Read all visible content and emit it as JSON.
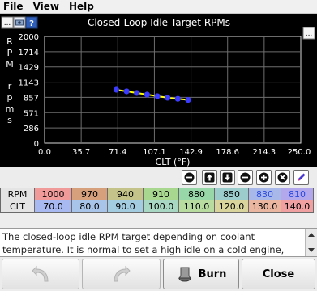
{
  "menu": {
    "items": [
      "File",
      "View",
      "Help"
    ]
  },
  "chart": {
    "title": "Closed-Loop Idle Target RPMs",
    "ylabel_top": "RPM",
    "ylabel_bottom": "rpms",
    "xlabel": "CLT (°F)",
    "yticks": [
      "2000",
      "1714",
      "1429",
      "1143",
      "857",
      "571",
      "286",
      "0"
    ],
    "xticks": [
      "0.0",
      "35.7",
      "71.4",
      "107.1",
      "142.9",
      "178.6",
      "214.3",
      "250.0"
    ],
    "background": "#000000",
    "line_color": "#ffff00",
    "point_color": "#3c3cff"
  },
  "chart_data": {
    "type": "line",
    "title": "Closed-Loop Idle Target RPMs",
    "xlabel": "CLT (°F)",
    "ylabel": "RPM rpms",
    "x": [
      70.0,
      80.0,
      90.0,
      100.0,
      110.0,
      120.0,
      130.0,
      140.0
    ],
    "series": [
      {
        "values": [
          1000,
          970,
          940,
          910,
          880,
          850,
          830,
          810
        ]
      }
    ],
    "xlim": [
      0.0,
      250.0
    ],
    "ylim": [
      0,
      2000
    ],
    "grid": true
  },
  "toolbar": {
    "icons": [
      "minus-circle-icon",
      "arrow-up-icon",
      "arrow-down-icon",
      "minus-circle-icon",
      "plus-circle-icon",
      "times-circle-icon",
      "pen-icon"
    ]
  },
  "table": {
    "rpm_label": "RPM",
    "clt_label": "CLT",
    "rpm": [
      "1000",
      "970",
      "940",
      "910",
      "880",
      "850",
      "830",
      "810"
    ],
    "clt": [
      "70.0",
      "80.0",
      "90.0",
      "100.0",
      "110.0",
      "120.0",
      "130.0",
      "140.0"
    ],
    "rpm_colors": [
      "#f09a9a",
      "#d6a07c",
      "#c4c48a",
      "#a8d890",
      "#98d8a8",
      "#9ccccc",
      "#a8b8e8",
      "#b4a8ec"
    ],
    "clt_colors": [
      "#a8b8f0",
      "#a8c4e8",
      "#a4cce0",
      "#a8d8c4",
      "#b8dca0",
      "#d8d49c",
      "#eab6a0",
      "#f0a0a0"
    ],
    "rpm_text_colors": [
      "#000000",
      "#000000",
      "#000000",
      "#000000",
      "#000000",
      "#000000",
      "#2a4ae0",
      "#2a4ae0"
    ]
  },
  "description": {
    "text": "The closed-loop idle RPM target depending on coolant temperature. It is normal to set a high idle on a cold engine,"
  },
  "buttons": {
    "burn": "Burn",
    "close": "Close"
  }
}
